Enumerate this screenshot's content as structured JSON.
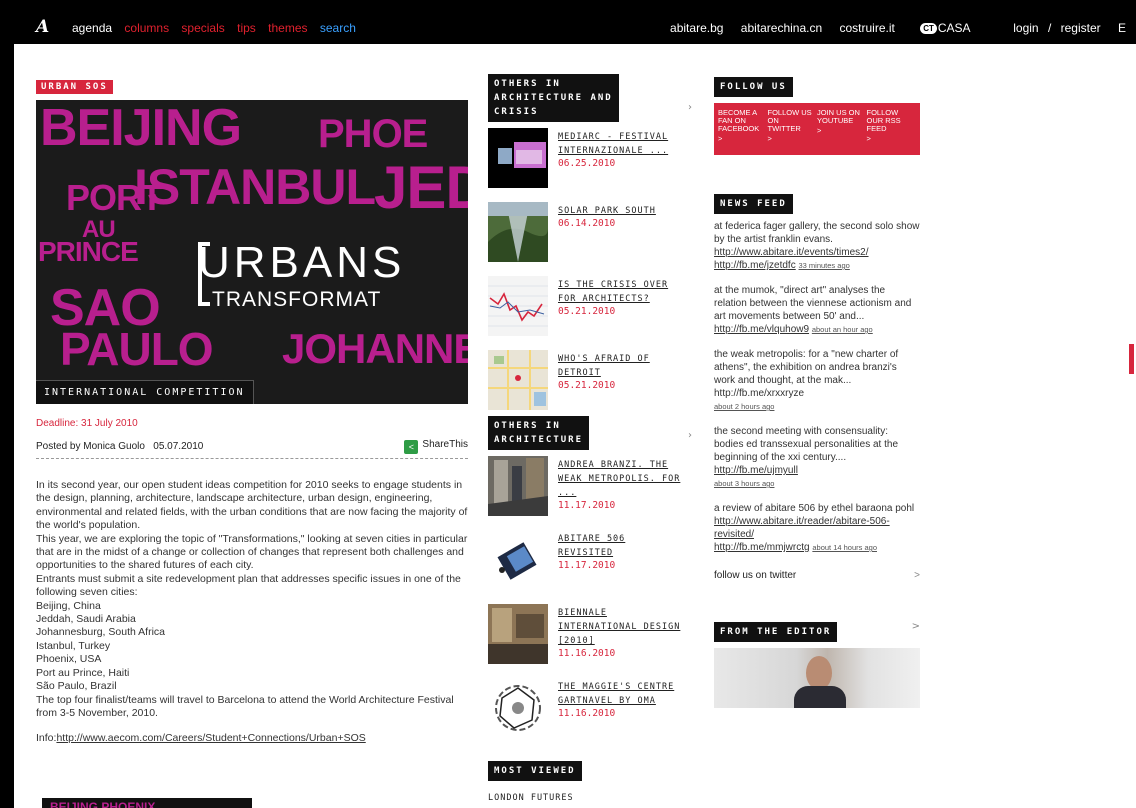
{
  "nav": {
    "logo": "A",
    "left": [
      {
        "label": "agenda",
        "color": "#ffffff"
      },
      {
        "label": "columns",
        "color": "#e0212e"
      },
      {
        "label": "specials",
        "color": "#e0212e"
      },
      {
        "label": "tips",
        "color": "#e0212e"
      },
      {
        "label": "themes",
        "color": "#e0212e"
      },
      {
        "label": "search",
        "color": "#3aa0ff"
      }
    ],
    "right": [
      "abitare.bg",
      "abitarechina.cn",
      "costruire.it"
    ],
    "casa_badge": "CT",
    "casa_label": "CASA",
    "login": "login",
    "slash": "/",
    "register": "register",
    "cut": "E"
  },
  "article": {
    "section_tag": "URBAN SOS",
    "hero_cities": [
      "BEIJING",
      "PHOE",
      "PORT",
      "AU",
      "PRINCE",
      "ISTANBUL",
      "JED",
      "SAO",
      "PAULO",
      "JOHANNES"
    ],
    "hero_title": "URBANS",
    "hero_subtitle": "TRANSFORMAT",
    "hero_caption": "INTERNATIONAL COMPETITION",
    "deadline": "Deadline: 31 July 2010",
    "byline": "Posted by Monica Guolo   05.07.2010",
    "share_label": "ShareThis",
    "body": [
      "In its second year, our open student ideas competition for 2010 seeks to engage students in the design, planning, architecture, landscape architecture, urban design, engineering, environmental and related fields, with the urban conditions that are now facing the majority of the world's population.",
      "This year, we are exploring the topic of \"Transformations,\" looking at seven cities in particular that are in the midst of a change or collection of changes that represent both challenges and opportunities to the shared futures of each city.",
      "Entrants must submit a site redevelopment plan that addresses specific issues in one of the following seven cities:",
      "Beijing, China",
      "Jeddah, Saudi Arabia",
      "Johannesburg, South Africa",
      "Istanbul, Turkey",
      "Phoenix, USA",
      "Port au Prince, Haiti",
      "São Paulo, Brazil",
      "The top four finalist/teams will travel to Barcelona to attend the World Architecture Festival from 3-5 November, 2010."
    ],
    "info_label": "Info:",
    "info_link": "http://www.aecom.com/Careers/Student+Connections/Urban+SOS",
    "bottom_tag": "BEIJING PHOENIX"
  },
  "others_crisis": {
    "heading_lines": [
      "OTHERS IN",
      "ARCHITECTURE AND",
      "CRISIS"
    ],
    "items": [
      {
        "title": "MEDIARC - FESTIVAL INTERNAZIONALE ...",
        "date": "06.25.2010"
      },
      {
        "title": "SOLAR PARK SOUTH",
        "date": "06.14.2010"
      },
      {
        "title": "IS THE CRISIS OVER FOR ARCHITECTS?",
        "date": "05.21.2010"
      },
      {
        "title": "WHO'S AFRAID OF DETROIT",
        "date": "05.21.2010"
      }
    ]
  },
  "others_arch": {
    "heading_lines": [
      "OTHERS IN",
      "ARCHITECTURE"
    ],
    "items": [
      {
        "title": "ANDREA BRANZI. THE WEAK METROPOLIS. FOR ...",
        "date": "11.17.2010"
      },
      {
        "title": "ABITARE 506 REVISITED",
        "date": "11.17.2010"
      },
      {
        "title": "BIENNALE INTERNATIONAL DESIGN [2010]",
        "date": "11.16.2010"
      },
      {
        "title": "THE MAGGIE'S CENTRE GARTNAVEL BY OMA",
        "date": "11.16.2010"
      }
    ]
  },
  "most_viewed": {
    "heading": "MOST VIEWED",
    "items": [
      "LONDON FUTURES"
    ]
  },
  "follow": {
    "heading": "FOLLOW US",
    "items": [
      {
        "label": "BECOME A FAN ON FACEBOOK",
        "arrow": ">"
      },
      {
        "label": "FOLLOW US ON TWITTER",
        "arrow": ">"
      },
      {
        "label": "JOIN US ON YOUTUBE",
        "arrow": ">"
      },
      {
        "label": "FOLLOW OUR RSS FEED",
        "arrow": ">"
      }
    ]
  },
  "news": {
    "heading": "NEWS FEED",
    "items": [
      {
        "text": "at federica fager gallery, the second solo show by the artist franklin evans.",
        "links": [
          "http://www.abitare.it/events/times2/",
          "http://fb.me/jzetdfc"
        ],
        "ago": "33 minutes ago"
      },
      {
        "text": "at the mumok, \"direct art\" analyses the relation between the viennese actionism and art movements between 50' and...",
        "links": [
          "http://fb.me/vlquhow9"
        ],
        "ago": "about an hour ago"
      },
      {
        "text": "the weak metropolis: for a \"new charter of athens\", the exhibition on andrea branzi's work and thought, at the mak... http://fb.me/xrxxryze",
        "links": [],
        "ago": "about 2 hours ago"
      },
      {
        "text": "the second meeting with consensuality: bodies ed transsexual personalities at the beginning of the xxi century....",
        "links": [
          "http://fb.me/ujmyull"
        ],
        "ago": "about 3 hours ago"
      },
      {
        "text": "a review of abitare 506 by ethel baraona pohl",
        "links": [
          "http://www.abitare.it/reader/abitare-506-revisited/",
          "http://fb.me/mmjwrctg"
        ],
        "ago": "about 14 hours ago"
      }
    ],
    "twitter": "follow us on twitter",
    "twitter_chev": ">"
  },
  "editor": {
    "heading": "FROM THE EDITOR",
    "chev": ">"
  },
  "colors": {
    "accent_red": "#d7263d",
    "magenta": "#b81f8e",
    "black": "#111111"
  }
}
